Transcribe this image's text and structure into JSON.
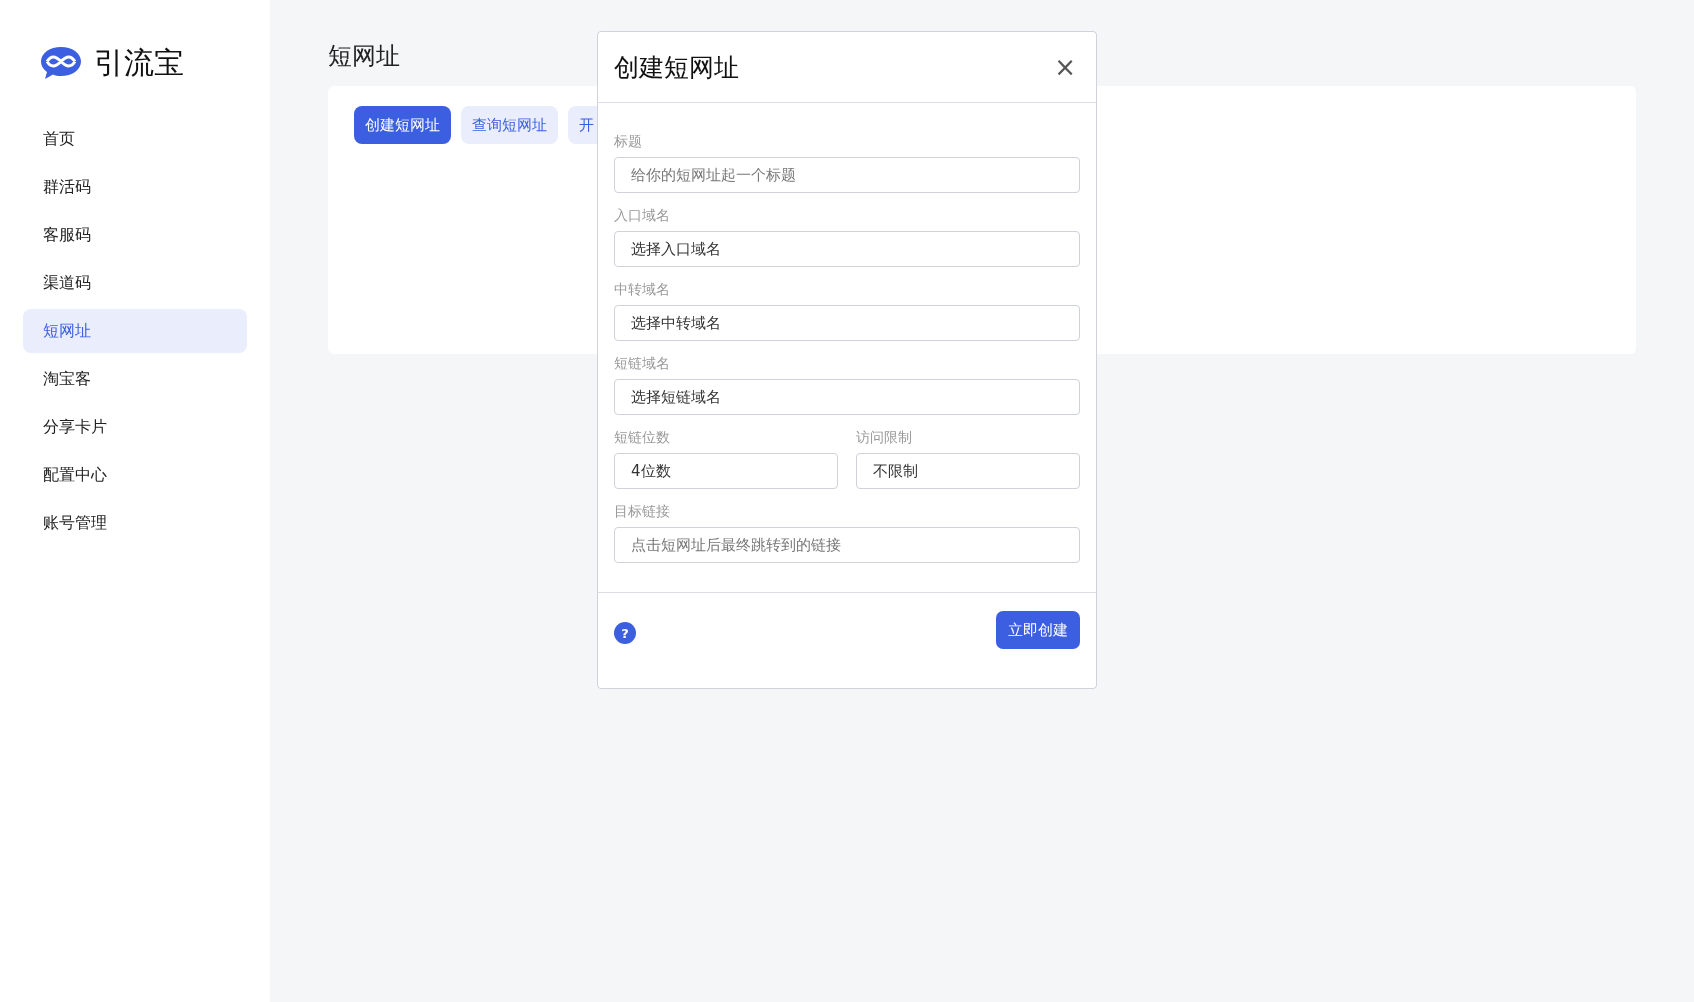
{
  "brand": {
    "name": "引流宝"
  },
  "sidebar": {
    "items": [
      {
        "label": "首页",
        "selected": false
      },
      {
        "label": "群活码",
        "selected": false
      },
      {
        "label": "客服码",
        "selected": false
      },
      {
        "label": "渠道码",
        "selected": false
      },
      {
        "label": "短网址",
        "selected": true
      },
      {
        "label": "淘宝客",
        "selected": false
      },
      {
        "label": "分享卡片",
        "selected": false
      },
      {
        "label": "配置中心",
        "selected": false
      },
      {
        "label": "账号管理",
        "selected": false
      }
    ]
  },
  "page": {
    "title": "短网址",
    "actions": [
      {
        "label": "创建短网址",
        "selected": true
      },
      {
        "label": "查询短网址",
        "selected": false
      },
      {
        "label": "开",
        "selected": false
      }
    ]
  },
  "dialog": {
    "title": "创建短网址",
    "close": "×",
    "rows": [
      [
        {
          "label": "标题",
          "placeholder": "给你的短网址起一个标题"
        }
      ],
      [
        {
          "label": "入口域名",
          "value": "选择入口域名"
        }
      ],
      [
        {
          "label": "中转域名",
          "value": "选择中转域名"
        }
      ],
      [
        {
          "label": "短链域名",
          "value": "选择短链域名"
        }
      ],
      [
        {
          "label": "短链位数",
          "value": "4位数"
        },
        {
          "label": "访问限制",
          "value": "不限制"
        }
      ],
      [
        {
          "label": "目标链接",
          "placeholder": "点击短网址后最终跳转到的链接"
        }
      ]
    ],
    "help": "?",
    "submit": "立即创建"
  }
}
